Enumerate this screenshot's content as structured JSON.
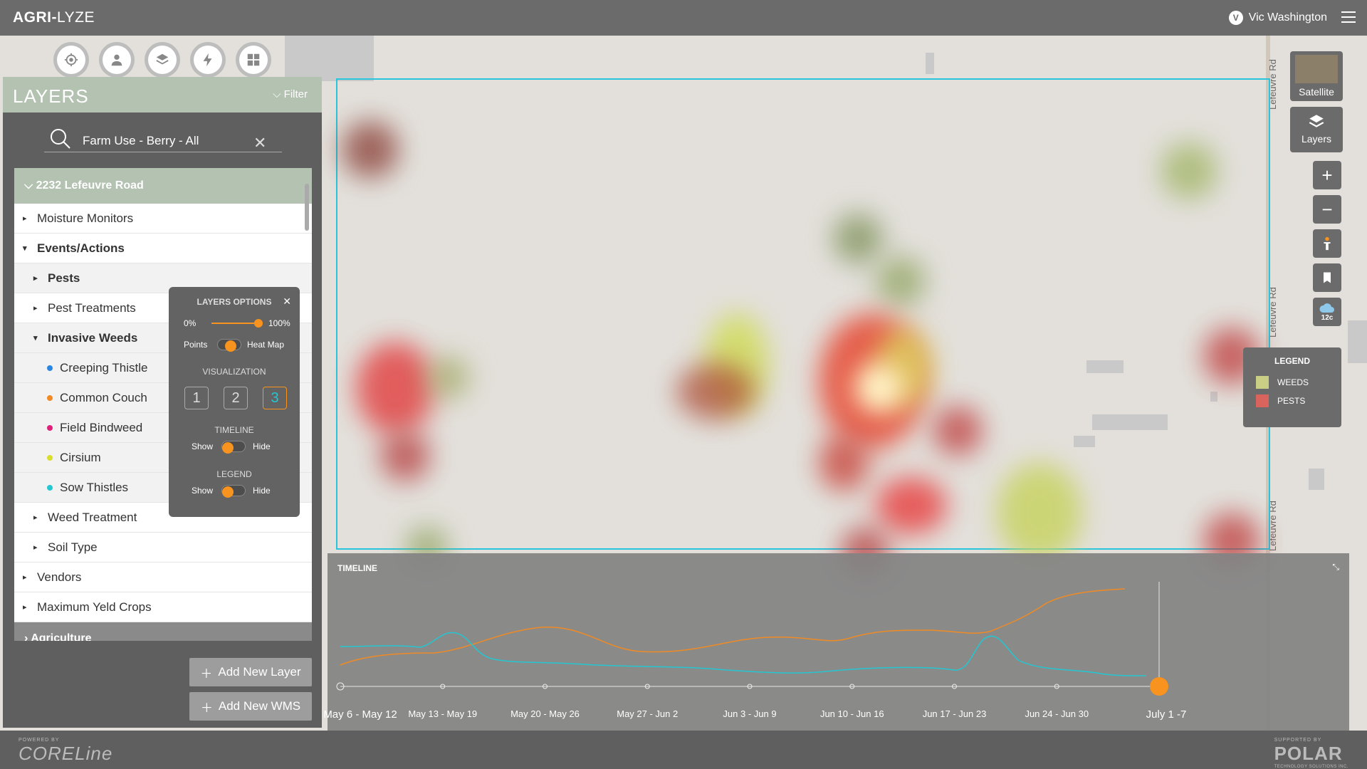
{
  "header": {
    "logo_bold": "AGRI-",
    "logo_rest": "LYZE",
    "user_initial": "V",
    "user_name": "Vic Washington"
  },
  "map": {
    "road_label": "Lefeuvre Rd",
    "field_border_color": "#29c5dd"
  },
  "toolbar": {
    "icons": [
      "location-icon",
      "user-icon",
      "layers-icon",
      "lightning-icon",
      "dashboard-icon"
    ]
  },
  "panel": {
    "title": "LAYERS",
    "filter_label": "Filter",
    "search_value": "Farm Use - Berry - All",
    "group_title": "2232 Lefeuvre Road",
    "rows": [
      {
        "label": "Moisture Monitors"
      },
      {
        "label": "Events/Actions"
      },
      {
        "label": "Pests"
      },
      {
        "label": "Pest Treatments"
      },
      {
        "label": "Invasive Weeds"
      },
      {
        "label": "Creeping Thistle",
        "color": "#2a86e0"
      },
      {
        "label": "Common Couch",
        "color": "#f08a24"
      },
      {
        "label": "Field Bindweed",
        "color": "#e0217a"
      },
      {
        "label": "Cirsium",
        "color": "#d9dd2c"
      },
      {
        "label": "Sow Thistles",
        "color": "#24c6d1"
      },
      {
        "label": "Weed Treatment"
      },
      {
        "label": "Soil Type"
      },
      {
        "label": "Vendors"
      },
      {
        "label": "Maximum Yeld Crops"
      }
    ],
    "next_group": "Agriculture",
    "add_layer_label": "Add New Layer",
    "add_wms_label": "Add New WMS"
  },
  "layers_options": {
    "title": "LAYERS OPTIONS",
    "opacity_min": "0%",
    "opacity_max": "100%",
    "opacity_value": 1.0,
    "points_label": "Points",
    "heatmap_label": "Heat Map",
    "visualization_label": "VISUALIZATION",
    "vis_options": [
      "1",
      "2",
      "3"
    ],
    "vis_selected": "3",
    "timeline_label": "TIMELINE",
    "legend_label": "LEGEND",
    "show_label": "Show",
    "hide_label": "Hide"
  },
  "map_controls": {
    "satellite_label": "Satellite",
    "layers_label": "Layers",
    "weather_temp": "12c"
  },
  "legend": {
    "title": "LEGEND",
    "items": [
      {
        "label": "WEEDS",
        "color": "#c9cf84"
      },
      {
        "label": "PESTS",
        "color": "#d9635d"
      }
    ]
  },
  "timeline": {
    "title": "TIMELINE",
    "ticks": [
      "May 6 - May 12",
      "May 13 - May 19",
      "May 20 - May 26",
      "May 27 - Jun 2",
      "Jun 3 - Jun 9",
      "Jun 10 - Jun 16",
      "Jun 17 - Jun 23",
      "Jun 24 - Jun 30",
      "July 1 -7"
    ],
    "series_colors": {
      "orange": "#f08a24",
      "teal": "#24c6d1"
    }
  },
  "footer": {
    "powered_by": "POWERED BY",
    "coreline": "CORELine",
    "supported_by": "SUPPORTED BY",
    "polar": "POLAR",
    "polar_sub": "TECHNOLOGY SOLUTIONS INC."
  }
}
